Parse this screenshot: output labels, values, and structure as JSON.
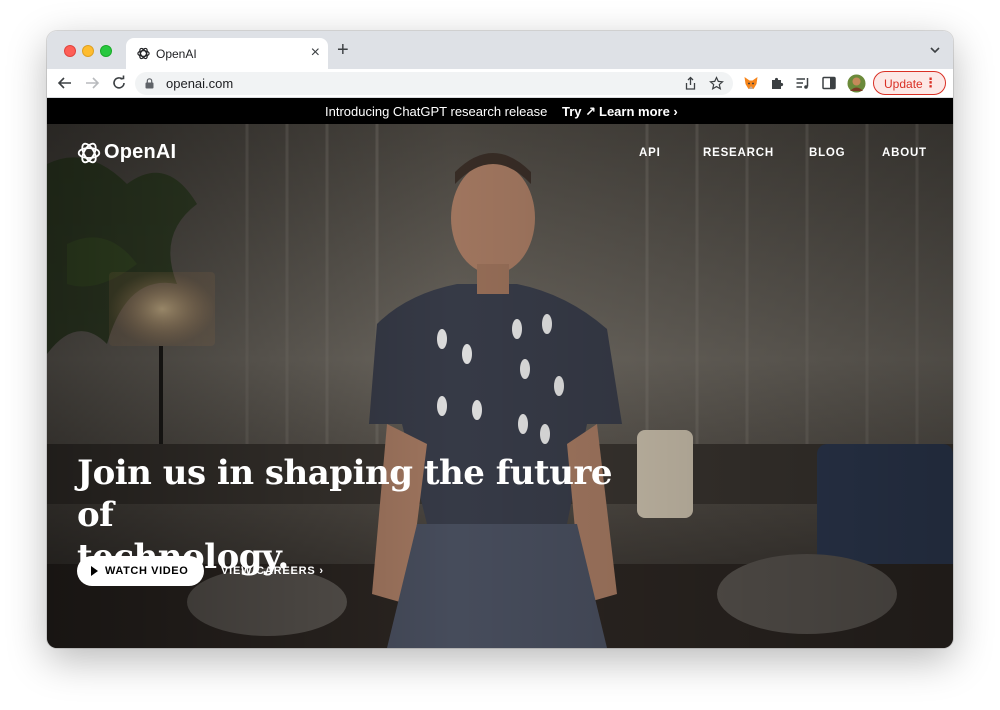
{
  "browser": {
    "tab": {
      "title": "OpenAI",
      "close_glyph": "×"
    },
    "new_tab_glyph": "+",
    "url": "openai.com",
    "update_label": "Update",
    "update_menu_glyph": "⋮",
    "colors": {
      "update": "#d93025",
      "tabstrip": "#dee1e6"
    }
  },
  "announcement": {
    "text": "Introducing ChatGPT research release",
    "try_label": "Try ↗",
    "learn_more_label": "Learn more ›"
  },
  "site": {
    "logo_text": "OpenAI",
    "nav": [
      "API",
      "RESEARCH",
      "BLOG",
      "ABOUT"
    ]
  },
  "hero": {
    "headline_line1": "Join us in shaping the future of",
    "headline_line2": "technology.",
    "watch_video_label": "WATCH VIDEO",
    "careers_label": "VIEW CAREERS ›"
  }
}
